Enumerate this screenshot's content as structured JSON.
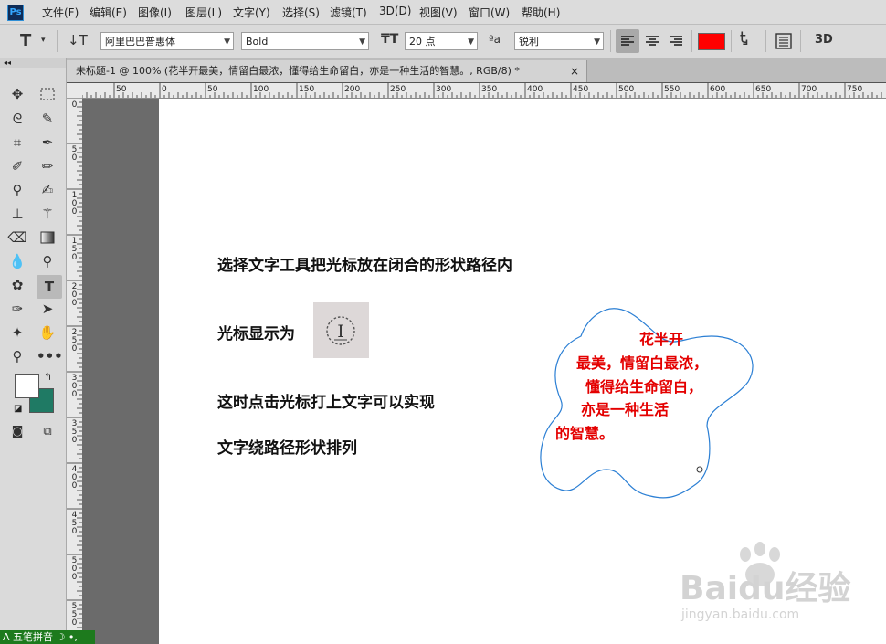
{
  "app": {
    "logo": "Ps"
  },
  "menu": [
    "文件(F)",
    "编辑(E)",
    "图像(I)",
    "图层(L)",
    "文字(Y)",
    "选择(S)",
    "滤镜(T)",
    "3D(D)",
    "视图(V)",
    "窗口(W)",
    "帮助(H)"
  ],
  "options": {
    "tool_glyph": "T",
    "font_family": "阿里巴巴普惠体",
    "font_style": "Bold",
    "font_size": "20 点",
    "aa_label": "ªa",
    "antialias": "锐利",
    "color_swatch": "#ff0000",
    "threed_label": "3D"
  },
  "tab": {
    "title": "未标题-1 @ 100% (花半开最美，情留白最浓，懂得给生命留白，亦是一种生活的智慧。, RGB/8) *",
    "close": "×"
  },
  "ruler": {
    "h_labels": [
      "50",
      "0",
      "50",
      "100",
      "150",
      "200",
      "250",
      "300",
      "350",
      "400",
      "450",
      "500",
      "550",
      "600",
      "650",
      "700",
      "750"
    ],
    "v_labels": [
      "0",
      "50",
      "100",
      "150",
      "200",
      "250",
      "300",
      "350",
      "400",
      "450",
      "500",
      "550"
    ]
  },
  "toolbox": {
    "fg_color": "#ffffff",
    "bg_color": "#1f7a64"
  },
  "canvas": {
    "line1": "选择文字工具把光标放在闭合的形状路径内",
    "line2": "光标显示为",
    "line3": "这时点击光标打上文字可以实现",
    "line4": "文字绕路径形状排列",
    "shape_text": [
      "花半开",
      "最美，情留白最浓，",
      "懂得给生命留白，",
      "亦是一种生活",
      "的智慧。"
    ],
    "shape_text_color": "#e40000",
    "path_color": "#2b7fd4"
  },
  "watermark": {
    "brand": "Baidu经验",
    "url": "jingyan.baidu.com"
  },
  "ime": {
    "label": "五笔拼音"
  }
}
